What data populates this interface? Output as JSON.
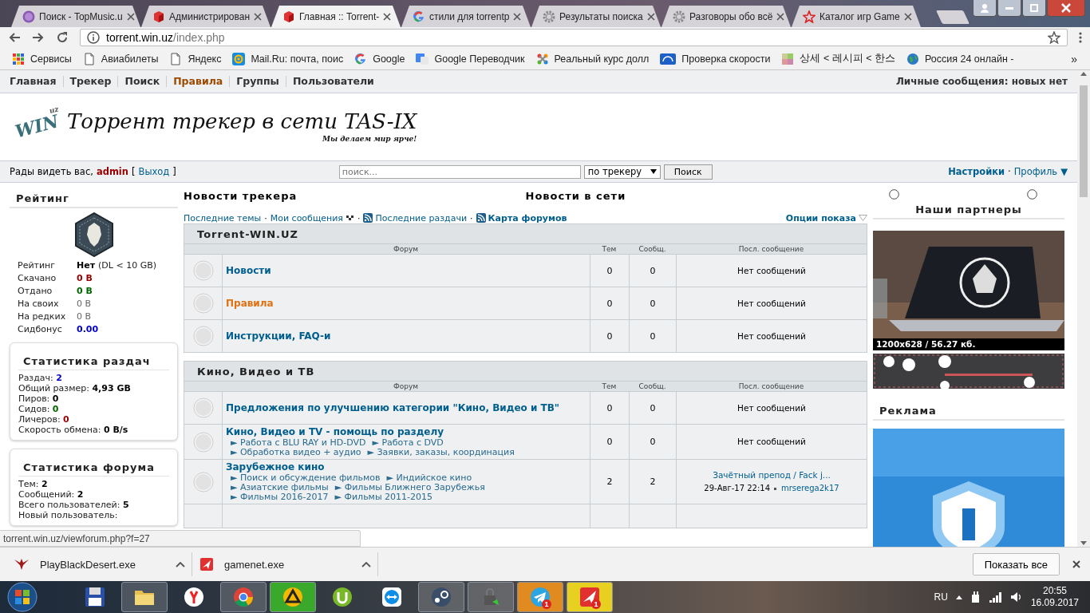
{
  "browser": {
    "tabs": [
      {
        "title": "Поиск - TopMusic.u",
        "selected": false
      },
      {
        "title": "Администрирован",
        "selected": false
      },
      {
        "title": "Главная :: Torrent-",
        "selected": true
      },
      {
        "title": "стили для torrentp",
        "selected": false
      },
      {
        "title": "Результаты поиска",
        "selected": false
      },
      {
        "title": "Разговоры обо всё",
        "selected": false
      },
      {
        "title": "Каталог игр Game",
        "selected": false
      }
    ],
    "address": {
      "host": "torrent.win.uz",
      "path": "/index.php"
    },
    "bookmarks": [
      {
        "label": "Сервисы"
      },
      {
        "label": "Авиабилеты"
      },
      {
        "label": "Яндекс"
      },
      {
        "label": "Mail.Ru: почта, поис"
      },
      {
        "label": "Google"
      },
      {
        "label": "Google Переводчик"
      },
      {
        "label": "Реальный курс долл"
      },
      {
        "label": "Проверка скорости"
      },
      {
        "label": "상세 < 레시피 < 한스"
      },
      {
        "label": "Россия 24 онлайн -"
      }
    ],
    "bookmarks_more": "»"
  },
  "site": {
    "nav": [
      {
        "label": "Главная",
        "selected": false
      },
      {
        "label": "Трекер",
        "selected": false
      },
      {
        "label": "Поиск",
        "selected": false
      },
      {
        "label": "Правила",
        "selected": true
      },
      {
        "label": "Группы",
        "selected": false
      },
      {
        "label": "Пользователи",
        "selected": false
      }
    ],
    "messages": "Личные сообщения: новых нет",
    "logo": {
      "mark": "WIN",
      "mark_sub": "uz",
      "title": "Торрент трекер в сети TAS-IX",
      "slogan": "Мы делаем мир ярче!"
    },
    "welcome": {
      "greeting": "Рады видеть вас,",
      "user": "admin",
      "open": "[",
      "logout": "Выход",
      "close": "]"
    },
    "search": {
      "placeholder": "поиск...",
      "scope": "по трекеру",
      "button": "Поиск"
    },
    "account": {
      "settings": "Настройки",
      "separator": "·",
      "profile": "Профиль",
      "caret": "▼"
    },
    "rating": {
      "title": "Рейтинг",
      "rows": [
        {
          "label": "Рейтинг",
          "value": "Нет",
          "note": "(DL < 10 GB)",
          "color": "#000000",
          "bold": true
        },
        {
          "label": "Скачано",
          "value": "0 B",
          "color": "#990000",
          "bold": true
        },
        {
          "label": "Отдано",
          "value": "0 B",
          "color": "#006600",
          "bold": true
        },
        {
          "label": "На своих",
          "value": "0 B",
          "color": "#666666",
          "bold": false
        },
        {
          "label": "На редких",
          "value": "0 B",
          "color": "#666666",
          "bold": false
        },
        {
          "label": "Сидбонус",
          "value": "0.00",
          "color": "#0000cc",
          "bold": true
        }
      ]
    },
    "stat_boxes": [
      {
        "title": "Статистика раздач",
        "rows": [
          {
            "label": "Раздач:",
            "value": "2",
            "color": "#0000cc"
          },
          {
            "label": "Общий размер:",
            "value": "4,93 GB",
            "color": "#000000"
          },
          {
            "label": "Пиров:",
            "value": "0",
            "color": "#000000"
          },
          {
            "label": "Сидов:",
            "value": "0",
            "color": "#006600"
          },
          {
            "label": "Личеров:",
            "value": "0",
            "color": "#990000"
          },
          {
            "label": "Скорость обмена:",
            "value": "0 B/s",
            "color": "#000000"
          }
        ]
      },
      {
        "title": "Статистика форума",
        "rows": [
          {
            "label": "Тем:",
            "value": "2",
            "color": "#000000"
          },
          {
            "label": "Сообщений:",
            "value": "2",
            "color": "#000000"
          },
          {
            "label": "Всего пользователей:",
            "value": "5",
            "color": "#000000"
          },
          {
            "label": "Новый пользователь:"
          }
        ]
      }
    ],
    "headings": [
      "Новости трекера",
      "Новости в сети"
    ],
    "quick_links": [
      {
        "label": "Последние темы",
        "bold": false
      },
      {
        "label": "Мои сообщения",
        "bold": false
      },
      {
        "label": "Последние раздачи",
        "bold": false
      },
      {
        "label": "Карта форумов",
        "bold": true
      }
    ],
    "link_separator": "·",
    "options": "Опции показа",
    "categories": [
      {
        "title": "Torrent-WIN.UZ",
        "columns": [
          "Форум",
          "Тем",
          "Сообщ.",
          "Посл. сообщение"
        ],
        "forums": [
          {
            "name": "Новости",
            "color": "#005e8f",
            "topics": "0",
            "posts": "0",
            "last": {
              "kind": "none",
              "text": "Нет сообщений"
            }
          },
          {
            "name": "Правила",
            "color": "#e07010",
            "topics": "0",
            "posts": "0",
            "last": {
              "kind": "none",
              "text": "Нет сообщений"
            }
          },
          {
            "name": "Инструкции, FAQ-и",
            "color": "#005e8f",
            "topics": "0",
            "posts": "0",
            "last": {
              "kind": "none",
              "text": "Нет сообщений"
            }
          }
        ]
      },
      {
        "title": "Кино, Видео и ТВ",
        "columns": [
          "Форум",
          "Тем",
          "Сообщ.",
          "Посл. сообщение"
        ],
        "forums": [
          {
            "name": "Предложения по улучшению категории \"Кино, Видео и ТВ\"",
            "color": "#005e8f",
            "topics": "0",
            "posts": "0",
            "last": {
              "kind": "none",
              "text": "Нет сообщений"
            }
          },
          {
            "name": "Кино, Видео и TV - помощь по разделу",
            "color": "#005e8f",
            "subforums": [
              "► Работа с BLU RAY и HD-DVD",
              "► Работа с DVD",
              "► Обработка видео + аудио",
              "► Заявки, заказы, координация"
            ],
            "topics": "0",
            "posts": "0",
            "last": {
              "kind": "none",
              "text": "Нет сообщений"
            }
          },
          {
            "name": "Зарубежное кино",
            "color": "#005e8f",
            "subforums": [
              "► Поиск и обсуждение фильмов",
              "► Индийское кино",
              "► Азиатские фильмы",
              "► Фильмы Ближнего Зарубежья",
              "► Фильмы 2016-2017",
              "► Фильмы 2011-2015"
            ],
            "topics": "2",
            "posts": "2",
            "last": {
              "kind": "post",
              "text": "Зачётный препод / Fack j...",
              "time": "29-Авг-17 22:14",
              "user": "mrserega2k17"
            }
          }
        ]
      }
    ],
    "partners": {
      "title": "Наши партнеры",
      "caption": "1200x628 / 56.27 кб."
    },
    "ads": {
      "title": "Реклама"
    },
    "status_url": "torrent.win.uz/viewforum.php?f=27"
  },
  "downloads": {
    "items": [
      {
        "name": "PlayBlackDesert.exe"
      },
      {
        "name": "gamenet.exe"
      }
    ],
    "show_all": "Показать все"
  },
  "taskbar": {
    "apps": [
      {
        "open": false
      },
      {
        "open": true
      },
      {
        "open": false
      },
      {
        "open": true
      },
      {
        "open": true
      },
      {
        "open": false
      },
      {
        "open": false
      },
      {
        "open": true
      },
      {
        "open": true
      },
      {
        "open": true,
        "badge": "1"
      },
      {
        "open": true,
        "badge": "1"
      }
    ],
    "lang": "RU",
    "time": "20:55",
    "date": "16.09.2017"
  }
}
